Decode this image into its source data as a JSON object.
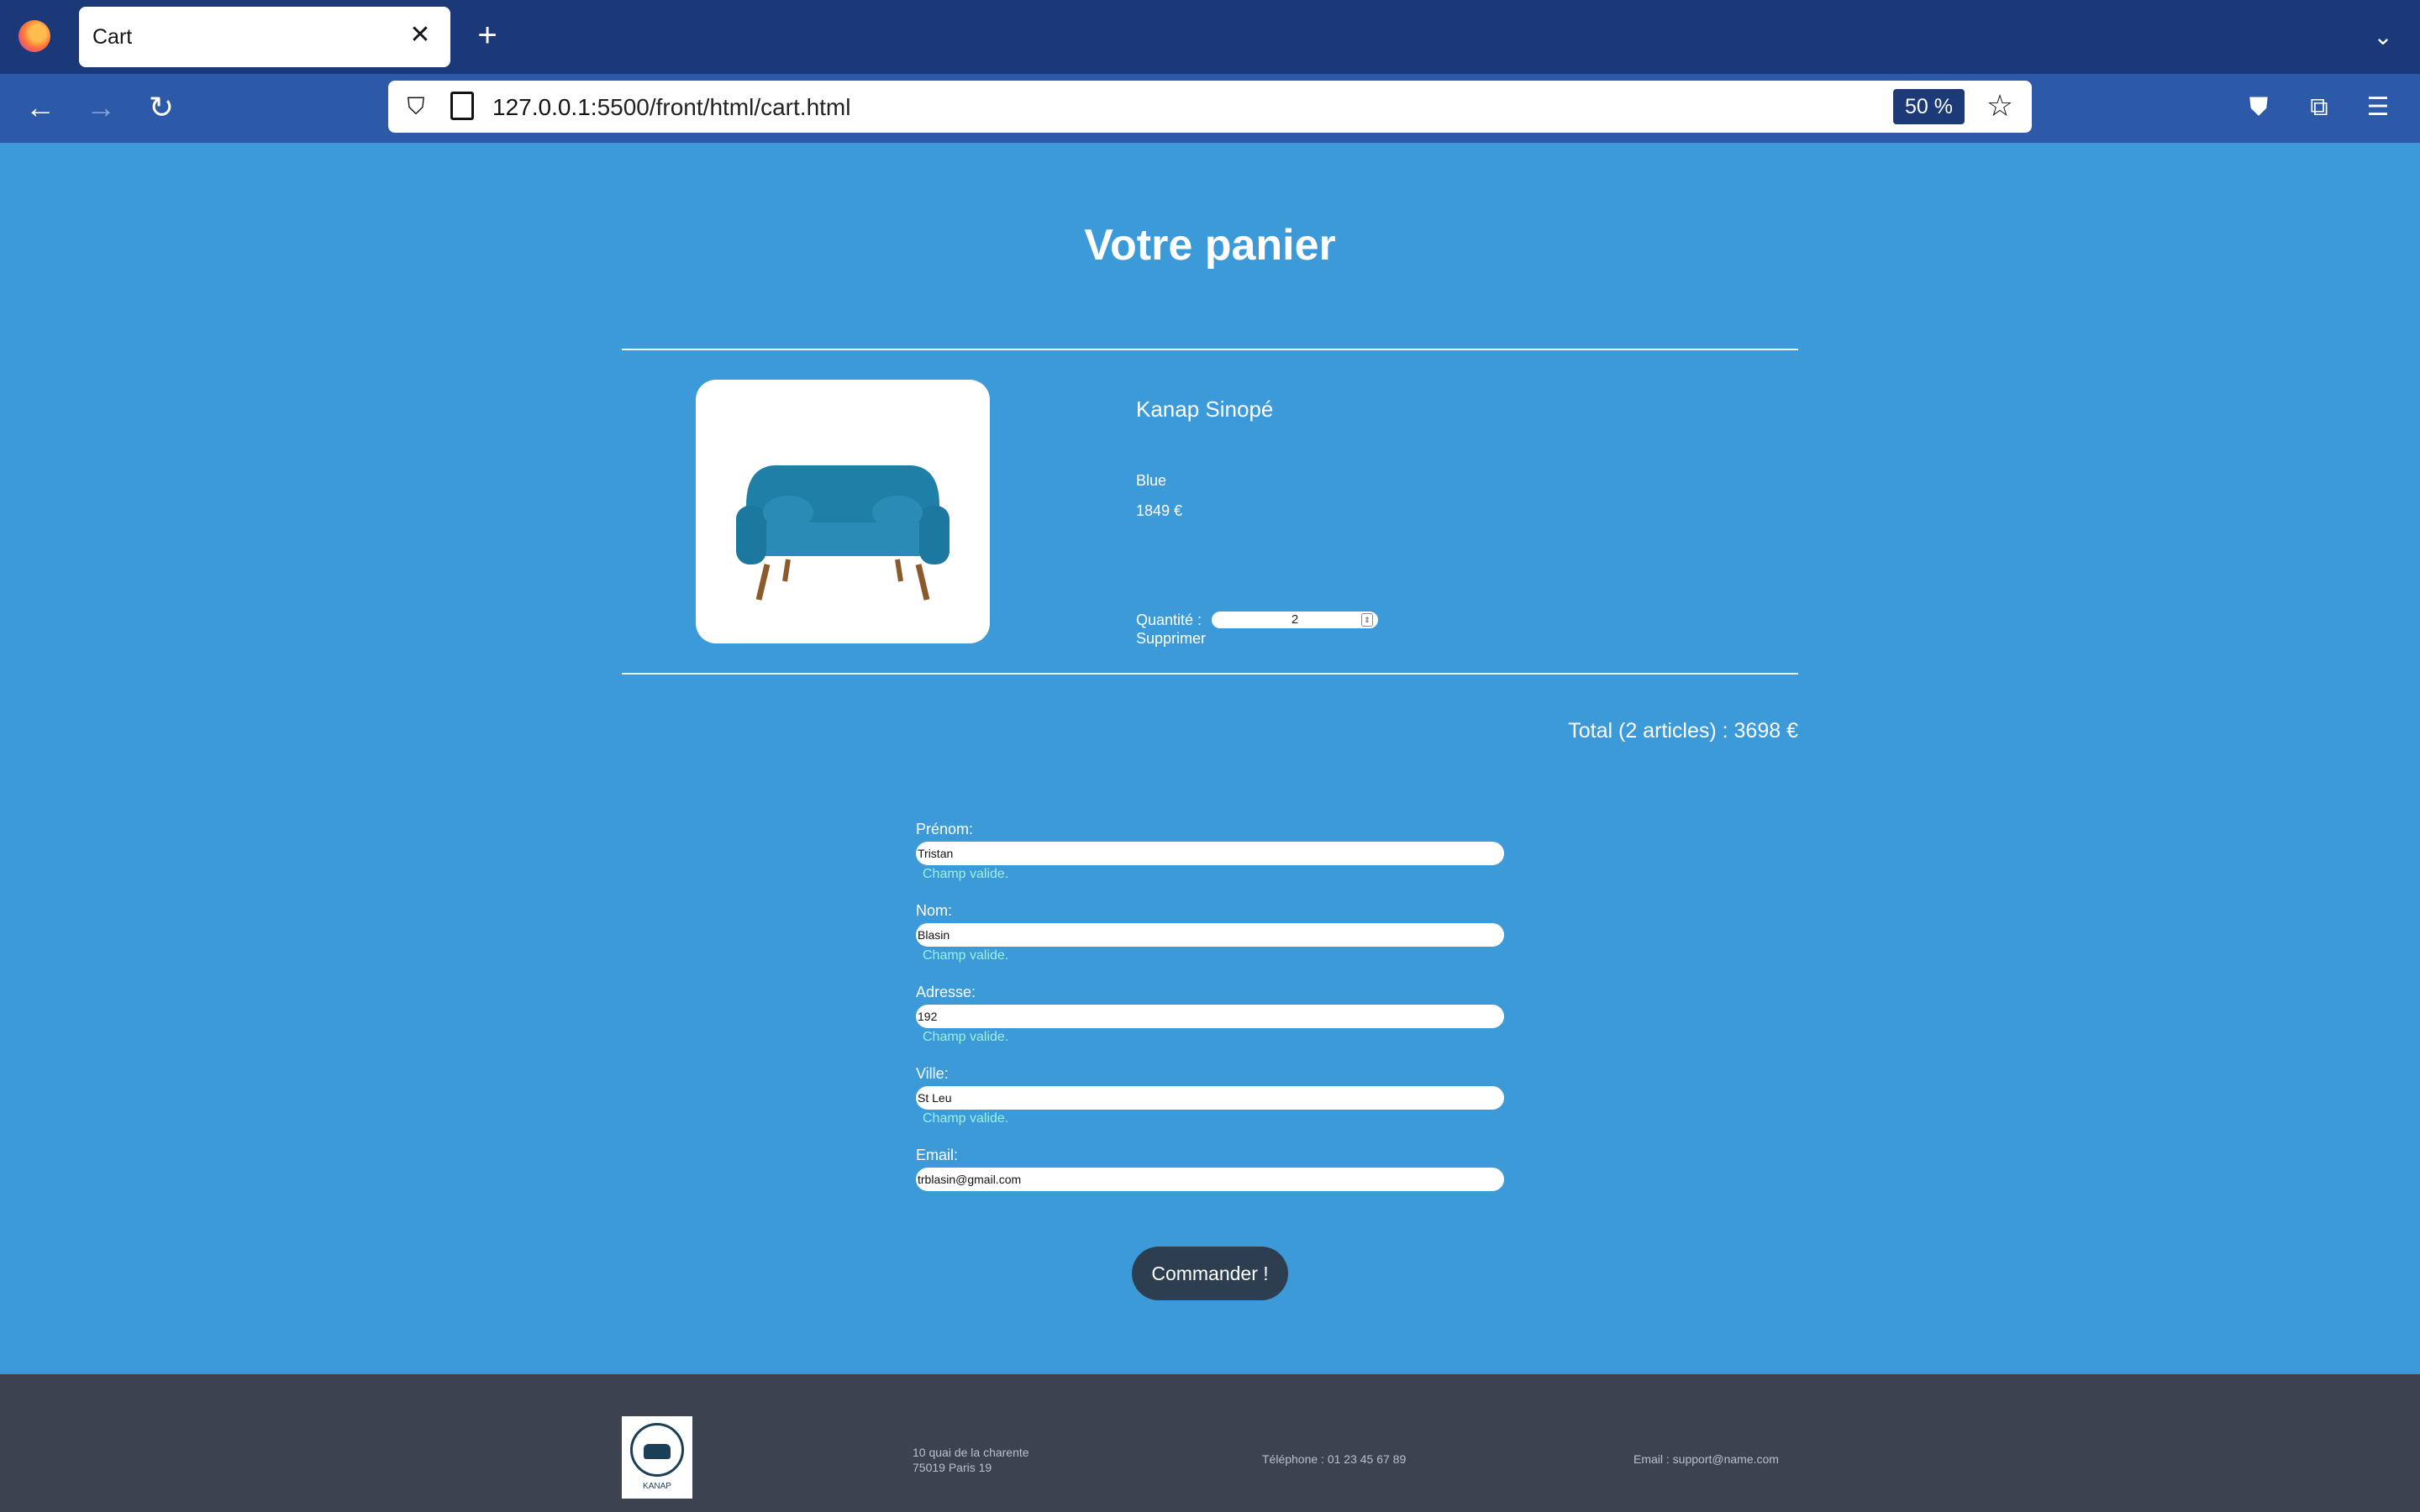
{
  "browser": {
    "tab_title": "Cart",
    "url_host": "127.0.0.1:",
    "url_rest": "5500/front/html/cart.html",
    "zoom": "50 %"
  },
  "page": {
    "title": "Votre panier",
    "item": {
      "name": "Kanap Sinopé",
      "color": "Blue",
      "price": "1849 €",
      "quantity_label": "Quantité :",
      "quantity": "2",
      "delete_label": "Supprimer"
    },
    "total": "Total (2 articles) : 3698 €",
    "form": {
      "first_name_label": "Prénom:",
      "first_name": "Tristan",
      "last_name_label": "Nom:",
      "last_name": "Blasin",
      "address_label": "Adresse:",
      "address": "192",
      "city_label": "Ville:",
      "city": "St Leu",
      "email_label": "Email:",
      "email": "trblasin@gmail.com",
      "valid_msg": "Champ valide.",
      "submit": "Commander !"
    }
  },
  "footer": {
    "logo_text": "KANAP",
    "address_line1": "10 quai de la charente",
    "address_line2": "75019 Paris 19",
    "phone": "Téléphone : 01 23 45 67 89",
    "email": "Email : support@name.com"
  }
}
